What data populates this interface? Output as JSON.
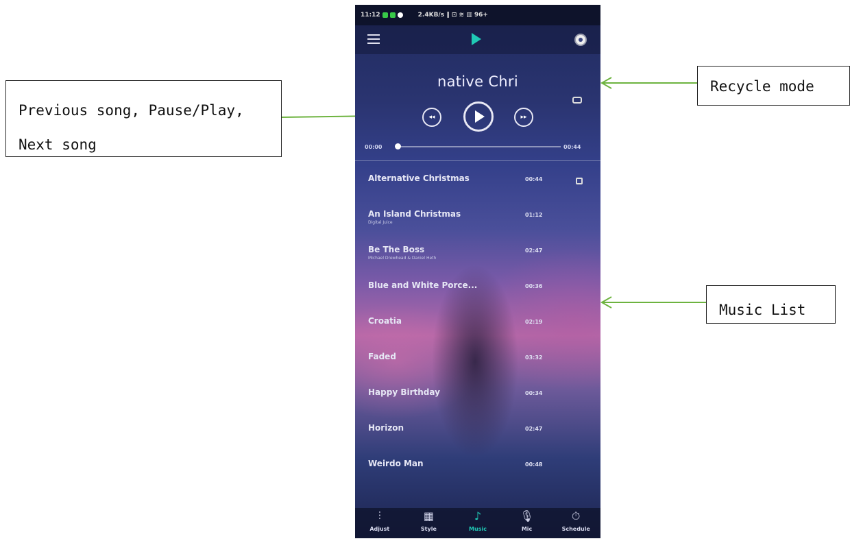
{
  "annotations": {
    "controls_line1": "Previous song, Pause/Play,",
    "controls_line2": "Next song",
    "recycle": "Recycle mode",
    "music_list": "Music List"
  },
  "status_bar": {
    "time": "11:12",
    "indicators": "2.4KB/s ‖ ⊡ ≋ ▥ 96+"
  },
  "app_bar": {
    "menu_icon": "menu-icon",
    "logo_icon": "play-logo-icon",
    "settings_icon": "gear-icon",
    "accent_color": "#20c9b5"
  },
  "player": {
    "title": "native Chri",
    "repeat_icon": "repeat-icon",
    "elapsed": "00:00",
    "duration": "00:44",
    "progress": 0.0
  },
  "tracks": [
    {
      "name": "Alternative Christmas",
      "artist": "",
      "time": "00:44"
    },
    {
      "name": "An Island Christmas",
      "artist": "Digital Juice",
      "time": "01:12"
    },
    {
      "name": "Be The Boss",
      "artist": "Michael Drewhead & Daniel Heth",
      "time": "02:47"
    },
    {
      "name": "Blue and White Porce...",
      "artist": "",
      "time": "00:36"
    },
    {
      "name": "Croatia",
      "artist": "",
      "time": "02:19"
    },
    {
      "name": "Faded",
      "artist": "",
      "time": "03:32"
    },
    {
      "name": "Happy Birthday",
      "artist": "",
      "time": "00:34"
    },
    {
      "name": "Horizon",
      "artist": "",
      "time": "02:47"
    },
    {
      "name": "Weirdo Man",
      "artist": "",
      "time": "00:48"
    }
  ],
  "bottom_nav": [
    {
      "label": "Adjust",
      "glyph": "⫶",
      "icon": "sliders-icon"
    },
    {
      "label": "Style",
      "glyph": "▦",
      "icon": "grid-icon"
    },
    {
      "label": "Music",
      "glyph": "♪",
      "icon": "music-note-icon"
    },
    {
      "label": "Mic",
      "glyph": "🎙",
      "icon": "mic-icon"
    },
    {
      "label": "Schedule",
      "glyph": "⏱",
      "icon": "timer-icon"
    }
  ]
}
